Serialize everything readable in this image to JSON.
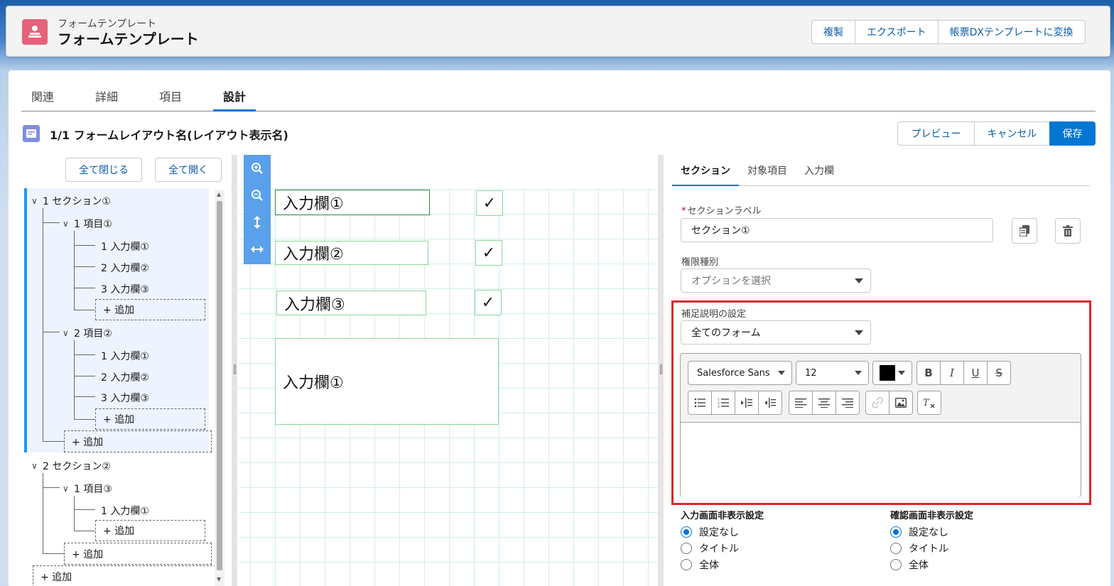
{
  "header": {
    "object_label": "フォームテンプレート",
    "record_title": "フォームテンプレート",
    "actions": [
      "複製",
      "エクスポート",
      "帳票DXテンプレートに変換"
    ]
  },
  "tabs": [
    "関連",
    "詳細",
    "項目",
    "設計"
  ],
  "active_tab": "設計",
  "layout": {
    "title": "1/1 フォームレイアウト名(レイアウト表示名)",
    "actions": {
      "preview": "プレビュー",
      "cancel": "キャンセル",
      "save": "保存"
    }
  },
  "tree": {
    "collapse_all": "全て閉じる",
    "expand_all": "全て開く",
    "sections": [
      {
        "label": "1 セクション①",
        "items": [
          {
            "label": "1 項目①",
            "fields": [
              "1 入力欄①",
              "2 入力欄②",
              "3 入力欄③"
            ]
          },
          {
            "label": "2 項目②",
            "fields": [
              "1 入力欄①",
              "2 入力欄②",
              "3 入力欄③"
            ]
          }
        ]
      },
      {
        "label": "2 セクション②",
        "items": [
          {
            "label": "1 項目③",
            "fields": [
              "1 入力欄①"
            ]
          }
        ]
      }
    ],
    "add_label": "+ 追加"
  },
  "canvas": {
    "fields": [
      "入力欄①",
      "入力欄②",
      "入力欄③",
      "入力欄①"
    ],
    "check_mark": "✓"
  },
  "right_panel": {
    "tabs": [
      "セクション",
      "対象項目",
      "入力欄"
    ],
    "active_tab": "セクション",
    "section_label": {
      "label": "セクションラベル",
      "required_mark": "*",
      "value": "セクション①"
    },
    "permission": {
      "label": "権限種別",
      "placeholder": "オプションを選択"
    },
    "supplement": {
      "label": "補足説明の設定",
      "value": "全てのフォーム"
    },
    "rte": {
      "font": "Salesforce Sans",
      "size": "12",
      "color": "#000000"
    },
    "input_hide": {
      "label": "入力画面非表示設定",
      "options": [
        "設定なし",
        "タイトル",
        "全体"
      ],
      "selected": "設定なし"
    },
    "confirm_hide": {
      "label": "確認画面非表示設定",
      "options": [
        "設定なし",
        "タイトル",
        "全体"
      ],
      "selected": "設定なし"
    }
  },
  "colors": {
    "brand": "#0176d3",
    "highlight_box": "#e3242b",
    "app_icon": "#e4627a"
  }
}
